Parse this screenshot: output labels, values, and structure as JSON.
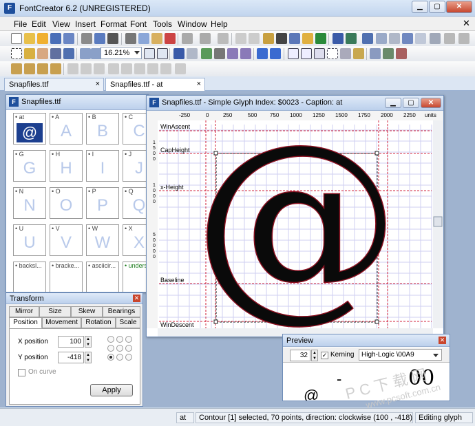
{
  "app": {
    "title": "FontCreator 6.2 (UNREGISTERED)",
    "icon_text": "F"
  },
  "menu": [
    "File",
    "Edit",
    "View",
    "Insert",
    "Format",
    "Font",
    "Tools",
    "Window",
    "Help"
  ],
  "toolbar": {
    "zoom_value": "16.21%"
  },
  "doc_tabs": [
    {
      "label": "Snapfiles.ttf",
      "close": "×"
    },
    {
      "label": "Snapfiles.ttf - at",
      "close": "×"
    }
  ],
  "font_window": {
    "title": "Snapfiles.ttf",
    "cells": [
      {
        "label": "• at",
        "glyph": "@"
      },
      {
        "label": "• A",
        "glyph": "A"
      },
      {
        "label": "• B",
        "glyph": "B"
      },
      {
        "label": "• C",
        "glyph": "C"
      },
      {
        "label": "• G",
        "glyph": "G"
      },
      {
        "label": "• H",
        "glyph": "H"
      },
      {
        "label": "• I",
        "glyph": "I"
      },
      {
        "label": "• J",
        "glyph": "J"
      },
      {
        "label": "• N",
        "glyph": "N"
      },
      {
        "label": "• O",
        "glyph": "O"
      },
      {
        "label": "• P",
        "glyph": "P"
      },
      {
        "label": "• Q",
        "glyph": "Q"
      },
      {
        "label": "• U",
        "glyph": "U"
      },
      {
        "label": "• V",
        "glyph": "V"
      },
      {
        "label": "• W",
        "glyph": "W"
      },
      {
        "label": "• X",
        "glyph": "X"
      },
      {
        "label": "• backsl...",
        "glyph": ""
      },
      {
        "label": "• bracke...",
        "glyph": ""
      },
      {
        "label": "• asciicir...",
        "glyph": ""
      },
      {
        "label": "• unders...",
        "glyph": ""
      }
    ]
  },
  "glyph_window": {
    "title": "Snapfiles.ttf - Simple Glyph Index: $0023 - Caption: at",
    "ruler": [
      "-250",
      "0",
      "250",
      "500",
      "750",
      "1000",
      "1250",
      "1500",
      "1750",
      "2000",
      "2250",
      "units"
    ],
    "guides": {
      "win_ascent": "WinAscent",
      "cap_height": "CapHeight",
      "x_height": "x-Height",
      "baseline": "Baseline",
      "win_descent": "WinDescent"
    },
    "vruler": [
      "1",
      "5",
      "0",
      "0",
      "1",
      "0",
      "0",
      "0",
      "5",
      "0",
      "0",
      "0",
      "0"
    ],
    "glyph": "@"
  },
  "transform": {
    "title": "Transform",
    "tabs_row1": [
      "Mirror",
      "Size",
      "Skew",
      "Bearings"
    ],
    "tabs_row2": [
      "Position",
      "Movement",
      "Rotation",
      "Scale"
    ],
    "x_label": "X position",
    "x_value": "100",
    "y_label": "Y position",
    "y_value": "-418",
    "on_curve": "On curve",
    "apply": "Apply"
  },
  "preview": {
    "title": "Preview",
    "size": "32",
    "kerning": "Kerning",
    "mode": "High-Logic \\00A9",
    "sample_text": "00"
  },
  "status": {
    "glyph": "at",
    "message": "Contour [1] selected, 70 points, direction: clockwise (100 , -418)",
    "mode": "Editing glyph"
  },
  "watermark": {
    "text": "PC下载网",
    "url": "www.pcsoft.com.cn"
  },
  "colors": {
    "accent": "#1c3f8f",
    "glyph_light": "#b8c9ea",
    "grid": "#c9c9f0",
    "guide": "#d0203a"
  }
}
